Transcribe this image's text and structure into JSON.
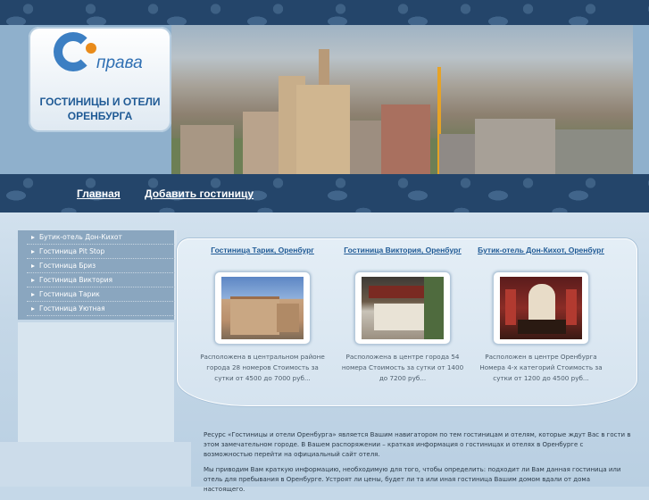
{
  "header": {
    "logo_word": "права",
    "title_line1": "ГОСТИНИЦЫ И ОТЕЛИ",
    "title_line2": "ОРЕНБУРГА"
  },
  "nav": {
    "home": "Главная",
    "add_hotel": "Добавить гостиницу"
  },
  "sidebar": {
    "items": [
      {
        "label": "Бутик-отель Дон-Кихот"
      },
      {
        "label": "Гостиница Pit Stop"
      },
      {
        "label": "Гостиница Бриз"
      },
      {
        "label": "Гостиница Виктория"
      },
      {
        "label": "Гостиница Тарик"
      },
      {
        "label": "Гостиница Уютная"
      }
    ]
  },
  "cards": [
    {
      "title": "Гостиница Тарик, Оренбург",
      "description": "Расположена в центральном районе города 28 номеров Стоимость за сутки от 4500 до 7000 руб..."
    },
    {
      "title": "Гостиница Виктория, Оренбург",
      "description": "Расположена в центре города 54 номера Стоимость за сутки от 1400 до 7200 руб..."
    },
    {
      "title": "Бутик-отель Дон-Кихот, Оренбург",
      "description": "Расположен в центре Оренбурга Номера 4-х категорий Стоимость за сутки от 1200 до 4500 руб..."
    }
  ],
  "info": {
    "paragraph1": "Ресурс «Гостиницы и отели Оренбурга» является Вашим навигатором по тем гостиницам и отелям, которые ждут Вас в гости в этом замечательном городе. В Вашем распоряжении – краткая информация о гостиницах и отелях в Оренбурге с возможностью перейти на официальный сайт отеля.",
    "paragraph2": "Мы приводим Вам краткую информацию, необходимую для того, чтобы определить: подходит ли Вам данная гостиница или отель для пребывания в Оренбурге. Устроят ли цены, будет ли та или иная гостиница Вашим домом вдали от дома настоящего."
  },
  "colors": {
    "ornament": "#24456a",
    "link": "#1f5a95",
    "logo_blue": "#3c7fc3",
    "logo_orange": "#e98b1a"
  }
}
